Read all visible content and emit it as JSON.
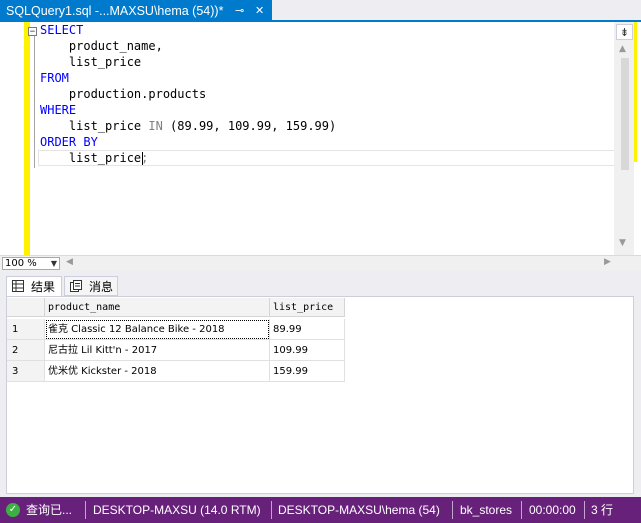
{
  "window": {
    "tab_title": "SQLQuery1.sql -...MAXSU\\hema (54))*",
    "pin_glyph": "⊸",
    "close_glyph": "✕"
  },
  "editor": {
    "collapse_glyph": "−",
    "lines": [
      {
        "kw": "SELECT",
        "text": ""
      },
      {
        "kw": "",
        "text": "    product_name,"
      },
      {
        "kw": "",
        "text": "    list_price"
      },
      {
        "kw": "FROM",
        "text": ""
      },
      {
        "kw": "",
        "text": "    production.products"
      },
      {
        "kw": "WHERE",
        "text": ""
      },
      {
        "kw": "",
        "text": "    list_price ",
        "in_kw": "IN",
        "tail": " (89.99, 109.99, 159.99)"
      },
      {
        "kw": "ORDER BY",
        "text": ""
      },
      {
        "kw": "",
        "text": "    list_price",
        "punct": ";"
      }
    ],
    "split_glyph": "⇟"
  },
  "zoom": {
    "value": "100 %"
  },
  "results_tabs": [
    {
      "label": "结果",
      "icon": "grid-icon"
    },
    {
      "label": "消息",
      "icon": "messages-icon"
    }
  ],
  "grid": {
    "columns": [
      "product_name",
      "list_price"
    ],
    "rows": [
      {
        "num": "1",
        "product_name": "雀克 Classic 12 Balance Bike - 2018",
        "list_price": "89.99"
      },
      {
        "num": "2",
        "product_name": "尼古拉 Lil Kitt'n - 2017",
        "list_price": "109.99"
      },
      {
        "num": "3",
        "product_name": "优米优 Kickster - 2018",
        "list_price": "159.99"
      }
    ]
  },
  "status_bar": {
    "state": "查询已...",
    "server": "DESKTOP-MAXSU (14.0 RTM)",
    "user": "DESKTOP-MAXSU\\hema (54)",
    "database": "bk_stores",
    "elapsed": "00:00:00",
    "rows": "3 行",
    "color": "#68217A"
  }
}
